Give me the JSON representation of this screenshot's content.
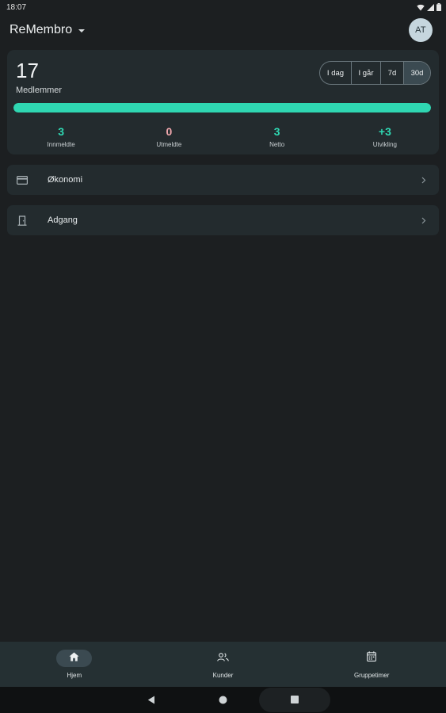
{
  "status_bar": {
    "time": "18:07"
  },
  "app_bar": {
    "org_name": "ReMembro",
    "avatar_initials": "AT"
  },
  "stats": {
    "members_count": "17",
    "members_label": "Medlemmer",
    "range_options": [
      "I dag",
      "I går",
      "7d",
      "30d"
    ],
    "selected_range": "30d",
    "progress_fraction": 1.0,
    "items": [
      {
        "value": "3",
        "label": "Innmeldte",
        "color": "#2fd7b2"
      },
      {
        "value": "0",
        "label": "Utmeldte",
        "color": "#f0a7ad"
      },
      {
        "value": "3",
        "label": "Netto",
        "color": "#2fd7b2"
      },
      {
        "value": "+3",
        "label": "Utvikling",
        "color": "#2fd7b2"
      }
    ]
  },
  "menu": [
    {
      "label": "Økonomi",
      "icon": "card-icon"
    },
    {
      "label": "Adgang",
      "icon": "door-icon"
    }
  ],
  "bottom_nav": [
    {
      "label": "Hjem",
      "icon": "home-icon",
      "active": true
    },
    {
      "label": "Kunder",
      "icon": "people-icon",
      "active": false
    },
    {
      "label": "Gruppetimer",
      "icon": "calendar-icon",
      "active": false
    }
  ],
  "colors": {
    "accent": "#2fd7b2",
    "negative": "#f0a7ad",
    "background": "#1c1f21",
    "card": "#232b2e"
  }
}
